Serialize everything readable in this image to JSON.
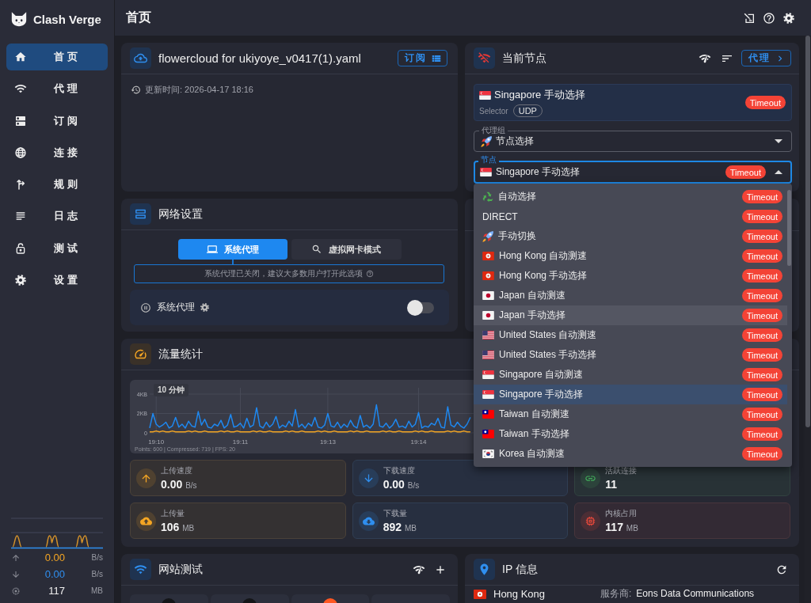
{
  "sidebar": {
    "app_name": "Clash Verge",
    "nav_items": [
      {
        "label": "首页",
        "kind": "home",
        "selected": true
      },
      {
        "label": "代理",
        "kind": "wifi",
        "selected": false
      },
      {
        "label": "订阅",
        "kind": "server",
        "selected": false
      },
      {
        "label": "连接",
        "kind": "globe",
        "selected": false
      },
      {
        "label": "规则",
        "kind": "fork",
        "selected": false
      },
      {
        "label": "日志",
        "kind": "lines",
        "selected": false
      },
      {
        "label": "测试",
        "kind": "lock",
        "selected": false
      },
      {
        "label": "设置",
        "kind": "gear",
        "selected": false
      }
    ],
    "traffic": [
      {
        "kind": "upload",
        "value": "0.00",
        "unit": "B/s"
      },
      {
        "kind": "download",
        "value": "0.00",
        "unit": "B/s"
      },
      {
        "kind": "memory",
        "value": "117",
        "unit": "MB"
      }
    ]
  },
  "header": {
    "title": "首页"
  },
  "profile_card": {
    "title": "flowercloud for ukiyoye_v0417(1).yaml",
    "button": "订阅",
    "updated": "更新时间: 2026-04-17 18:16"
  },
  "network_card": {
    "title": "网络设置",
    "modes": [
      {
        "label": "系统代理",
        "kind": "laptop",
        "selected": true
      },
      {
        "label": "虚拟网卡模式",
        "kind": "search",
        "selected": false
      }
    ],
    "hint": "系统代理已关闭，建议大多数用户打开此选项",
    "proxy_row": {
      "label": "系统代理",
      "on": false
    }
  },
  "node_card": {
    "title": "当前节点",
    "button": "代理",
    "current": {
      "kind": "sg",
      "name": "Singapore 手动选择",
      "type": "Selector",
      "udp": "UDP",
      "delay": "Timeout"
    },
    "group_field": {
      "label": "代理组",
      "kind": "rocket",
      "value": "节点选择"
    },
    "node_field": {
      "label": "节点",
      "kind": "sg",
      "value": "Singapore 手动选择",
      "delay": "Timeout",
      "expanded": true
    },
    "menu": [
      {
        "kind": "recycle",
        "name": "自动选择",
        "delay": "Timeout",
        "selected": false,
        "hovered": false
      },
      {
        "kind": "plain",
        "name": "DIRECT",
        "delay": "Timeout",
        "selected": false,
        "hovered": false
      },
      {
        "kind": "rocket",
        "name": "手动切换",
        "delay": "Timeout",
        "selected": false,
        "hovered": false
      },
      {
        "kind": "hk",
        "name": "Hong Kong 自动测速",
        "delay": "Timeout",
        "selected": false,
        "hovered": false
      },
      {
        "kind": "hk",
        "name": "Hong Kong 手动选择",
        "delay": "Timeout",
        "selected": false,
        "hovered": false
      },
      {
        "kind": "jp",
        "name": "Japan 自动测速",
        "delay": "Timeout",
        "selected": false,
        "hovered": false
      },
      {
        "kind": "jp",
        "name": "Japan 手动选择",
        "delay": "Timeout",
        "selected": false,
        "hovered": true
      },
      {
        "kind": "us",
        "name": "United States 自动测速",
        "delay": "Timeout",
        "selected": false,
        "hovered": false
      },
      {
        "kind": "us",
        "name": "United States 手动选择",
        "delay": "Timeout",
        "selected": false,
        "hovered": false
      },
      {
        "kind": "sg",
        "name": "Singapore 自动测速",
        "delay": "Timeout",
        "selected": false,
        "hovered": false
      },
      {
        "kind": "sg",
        "name": "Singapore 手动选择",
        "delay": "Timeout",
        "selected": true,
        "hovered": false
      },
      {
        "kind": "tw",
        "name": "Taiwan 自动测速",
        "delay": "Timeout",
        "selected": false,
        "hovered": false
      },
      {
        "kind": "tw",
        "name": "Taiwan 手动选择",
        "delay": "Timeout",
        "selected": false,
        "hovered": false
      },
      {
        "kind": "kr",
        "name": "Korea 自动测速",
        "delay": "Timeout",
        "selected": false,
        "hovered": false
      }
    ]
  },
  "traffic_card": {
    "title": "流量统计",
    "chart": {
      "range": "10 分钟",
      "footer": "Points: 600 | Compressed: 719 | FPS: 20",
      "chart_data": {
        "type": "line",
        "grid": true,
        "categories": [
          null,
          null,
          "19:10",
          null,
          null,
          null,
          null,
          null,
          null,
          null,
          null,
          null,
          null,
          null,
          null,
          null,
          null,
          null,
          null,
          null,
          null,
          null,
          null,
          null,
          null,
          null,
          null,
          null,
          "19:11",
          null,
          null,
          null,
          null,
          null,
          null,
          null,
          null,
          null,
          null,
          null,
          null,
          null,
          null,
          null,
          null,
          null,
          null,
          null,
          null,
          null,
          null,
          null,
          null,
          null,
          null,
          "19:13",
          null,
          null,
          null,
          null,
          null,
          null,
          null,
          null,
          null,
          null,
          null,
          null,
          null,
          null,
          null,
          null,
          null,
          null,
          null,
          null,
          null,
          null,
          null,
          null,
          null,
          null,
          null,
          "19:14",
          null,
          null,
          null,
          null,
          null,
          null,
          null,
          null,
          null,
          null,
          null,
          null,
          null,
          null,
          null,
          null
        ],
        "ylim": [
          0,
          4.6
        ],
        "yticks": [
          {
            "value": 0,
            "label": "0"
          },
          {
            "value": 2,
            "label": "2KB"
          },
          {
            "value": 4,
            "label": "4KB"
          }
        ],
        "series": [
          {
            "color": "#1e88f0",
            "values": [
              0.5,
              2.0,
              0.9,
              0.6,
              0.8,
              1.1,
              0.5,
              0.7,
              1.6,
              0.6,
              0.9,
              0.5,
              1.2,
              0.7,
              0.6,
              2.2,
              0.8,
              1.4,
              0.6,
              0.5,
              0.9,
              0.7,
              1.3,
              0.5,
              0.8,
              1.9,
              0.6,
              0.7,
              1.0,
              0.5,
              1.5,
              0.6,
              0.8,
              2.6,
              0.7,
              0.5,
              1.1,
              0.6,
              0.9,
              1.7,
              0.5,
              0.8,
              0.6,
              1.2,
              0.7,
              2.4,
              0.6,
              0.9,
              0.5,
              1.0,
              0.7,
              1.6,
              0.6,
              0.5,
              0.8,
              2.0,
              0.7,
              0.6,
              1.1,
              0.5,
              0.9,
              0.6,
              1.3,
              0.7,
              0.5,
              1.8,
              0.6,
              0.8,
              0.5,
              0.9,
              2.9,
              0.7,
              0.6,
              1.0,
              0.5,
              0.8,
              1.4,
              0.6,
              0.7,
              0.5,
              1.2,
              0.6,
              0.9,
              2.1,
              0.5,
              0.7,
              0.6,
              1.0,
              0.8,
              1.5,
              0.6,
              0.5,
              2.7,
              0.8,
              0.6,
              1.1,
              0.7,
              0.5,
              0.9,
              1.6
            ]
          },
          {
            "color": "#f5a623",
            "values": [
              0.1,
              0.1,
              0.2,
              0.1,
              0.2,
              0.1,
              0.1,
              0.2,
              0.1,
              0.1,
              0.1,
              0.1,
              0.2,
              0.1,
              0.2,
              0.1,
              0.1,
              0.2,
              0.1,
              0.1,
              0.1,
              0.1,
              0.2,
              0.1,
              0.2,
              0.1,
              0.1,
              0.2,
              0.1,
              0.1,
              0.1,
              0.1,
              0.2,
              0.1,
              0.2,
              0.1,
              0.1,
              0.2,
              0.1,
              0.1,
              0.1,
              0.1,
              0.2,
              0.1,
              0.2,
              0.1,
              0.1,
              0.2,
              0.1,
              0.1,
              0.1,
              0.1,
              0.2,
              0.1,
              0.2,
              0.1,
              0.1,
              0.2,
              0.1,
              0.1,
              0.1,
              0.1,
              0.2,
              0.1,
              0.2,
              0.1,
              0.1,
              0.2,
              0.1,
              0.1,
              0.1,
              0.1,
              0.2,
              0.1,
              0.2,
              0.1,
              0.1,
              0.2,
              0.1,
              0.1,
              0.1,
              0.1,
              0.2,
              0.1,
              0.2,
              0.1,
              0.1,
              0.2,
              0.1,
              0.1,
              0.1,
              0.1,
              0.2,
              0.1,
              0.2,
              0.1,
              0.1,
              0.2,
              0.1,
              0.1
            ]
          }
        ]
      }
    },
    "stats": [
      {
        "kind": "upload-speed",
        "label": "上传速度",
        "value": "0.00",
        "unit": "B/s",
        "color": "#f5a623"
      },
      {
        "kind": "download-speed",
        "label": "下载速度",
        "value": "0.00",
        "unit": "B/s",
        "color": "#2f8ff0"
      },
      {
        "kind": "connections",
        "label": "活跃连接",
        "value": "11",
        "color": "#43b05c"
      },
      {
        "kind": "upload-total",
        "label": "上传量",
        "value": "106",
        "unit": "MB",
        "color": "#f5a623"
      },
      {
        "kind": "download-total",
        "label": "下载量",
        "value": "892",
        "unit": "MB",
        "color": "#2f8ff0"
      },
      {
        "kind": "memory",
        "label": "内核占用",
        "value": "117",
        "unit": "MB",
        "color": "#e5483b"
      }
    ]
  },
  "site_test_card": {
    "title": "网站测试",
    "sites": [
      {
        "kind": "dark"
      },
      {
        "kind": "dark"
      },
      {
        "kind": "orange"
      },
      {
        "kind": "blank"
      }
    ]
  },
  "ip_card": {
    "title": "IP 信息",
    "kind": "hk",
    "country": "Hong Kong",
    "provider_label": "服务商:",
    "provider": "Eons Data Communications"
  }
}
